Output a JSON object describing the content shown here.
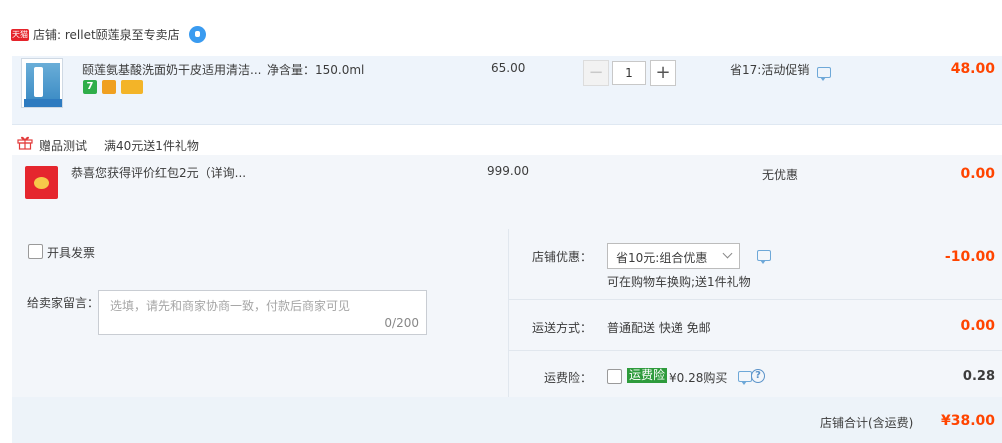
{
  "shop": {
    "badge": "天猫",
    "name": "店铺: rellet颐莲泉至专卖店"
  },
  "item": {
    "title": "颐莲氨基酸洗面奶干皮适用清洁...",
    "spec": "净含量：150.0ml",
    "tags": [
      {
        "text": "7",
        "color": "#2fae4a"
      },
      {
        "text": "",
        "color": "#f0a020"
      },
      {
        "text": "",
        "color": "#f0b030"
      }
    ],
    "unit_price": "65.00",
    "quantity": "1",
    "qty_minus": "−",
    "qty_plus": "+",
    "promo": "省17:活动促销",
    "subtotal": "48.00"
  },
  "gift": {
    "header_label": "赠品测试",
    "header_rule": "满40元送1件礼物",
    "title": "恭喜您获得评价红包2元（详询...",
    "price": "999.00",
    "promo": "无优惠",
    "subtotal": "0.00"
  },
  "invoice": {
    "label": "开具发票"
  },
  "message": {
    "label": "给卖家留言：",
    "placeholder": "选填，请先和商家协商一致，付款后商家可见",
    "counter": "0/200"
  },
  "discount": {
    "label": "店铺优惠：",
    "selected": "省10元:组合优惠",
    "note": "可在购物车换购;送1件礼物",
    "amount": "-10.00"
  },
  "shipping": {
    "label": "运送方式：",
    "value": "普通配送 快递 免邮",
    "amount": "0.00"
  },
  "insurance": {
    "label": "运费险：",
    "badge": "运费险",
    "text": "¥0.28购买",
    "amount": "0.28"
  },
  "total": {
    "label": "店铺合计(含运费)",
    "amount": "¥38.00"
  },
  "colors": {
    "accent_red": "#ff4400",
    "row_blue": "#eef4fb",
    "panel": "#f3f6fa"
  }
}
